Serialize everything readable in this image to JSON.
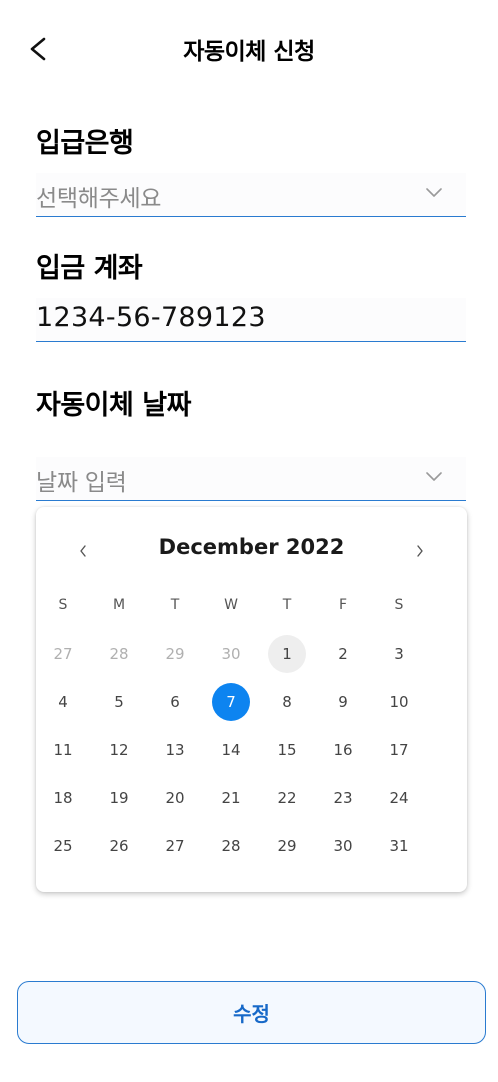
{
  "header": {
    "title": "자동이체 신청"
  },
  "bank": {
    "label": "입급은행",
    "placeholder": "선택해주세요"
  },
  "account": {
    "label": "입금 계좌",
    "value": "1234-56-789123"
  },
  "transfer_date": {
    "label": "자동이체 날짜",
    "placeholder": "날짜 입력"
  },
  "calendar": {
    "month_label": "December 2022",
    "weekdays": [
      "S",
      "M",
      "T",
      "W",
      "T",
      "F",
      "S"
    ],
    "weeks": [
      [
        "27",
        "28",
        "29",
        "30",
        "1",
        "2",
        "3"
      ],
      [
        "4",
        "5",
        "6",
        "7",
        "8",
        "9",
        "10"
      ],
      [
        "11",
        "12",
        "13",
        "14",
        "15",
        "16",
        "17"
      ],
      [
        "18",
        "19",
        "20",
        "21",
        "22",
        "23",
        "24"
      ],
      [
        "25",
        "26",
        "27",
        "28",
        "29",
        "30",
        "31"
      ]
    ],
    "outside_month_days": [
      "27",
      "28",
      "29",
      "30"
    ],
    "today": "1",
    "selected": "7"
  },
  "submit": {
    "label": "수정"
  },
  "colors": {
    "accent": "#0d84f0",
    "field_underline": "#2a7bd0",
    "button_text": "#1769c8",
    "button_bg": "#f4f9ff",
    "today_bg": "#eeeeee"
  }
}
